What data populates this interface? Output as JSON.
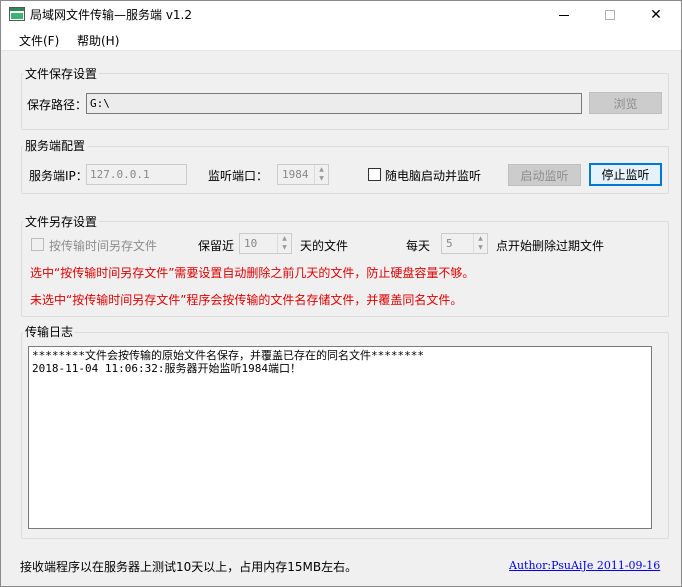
{
  "window": {
    "title": "局域网文件传输—服务端 v1.2",
    "icon": "app-window-icon",
    "minimize_glyph": "—",
    "close_glyph": "✕"
  },
  "menu": {
    "file": "文件(F)",
    "help": "帮助(H)"
  },
  "save_settings": {
    "group_label": "文件保存设置",
    "path_label": "保存路径：",
    "path_value": "G:\\",
    "browse_label": "浏览"
  },
  "server_config": {
    "group_label": "服务端配置",
    "ip_label": "服务端IP：",
    "ip_value": "127.0.0.1",
    "port_label": "监听端口：",
    "port_value": "1984",
    "autostart_label": "随电脑启动并监听",
    "autostart_checked": false,
    "start_label": "启动监听",
    "stop_label": "停止监听"
  },
  "save_as": {
    "group_label": "文件另存设置",
    "by_time_label": "按传输时间另存文件",
    "by_time_checked": false,
    "keep_prefix": "保留近",
    "keep_days_value": "10",
    "keep_suffix": "天的文件",
    "daily_prefix": "每天",
    "daily_hour_value": "5",
    "daily_suffix": "点开始删除过期文件",
    "note_checked": "选中“按传输时间另存文件”需要设置自动删除之前几天的文件，防止硬盘容量不够。",
    "note_unchecked": "未选中“按传输时间另存文件”程序会按传输的文件名存储文件，并覆盖同名文件。",
    "note_color": "#e00000"
  },
  "log": {
    "group_label": "传输日志",
    "lines": [
      "********文件会按传输的原始文件名保存，并覆盖已存在的同名文件********",
      "2018-11-04 11:06:32:服务器开始监听1984端口！"
    ]
  },
  "status": {
    "text": "接收端程序以在服务器上测试10天以上，占用内存15MB左右。",
    "author": "Author:PsuAiJe 2011-09-16"
  },
  "colors": {
    "window_bg": "#f0f0f0",
    "accent": "#0078d7",
    "link": "#0000ee"
  }
}
